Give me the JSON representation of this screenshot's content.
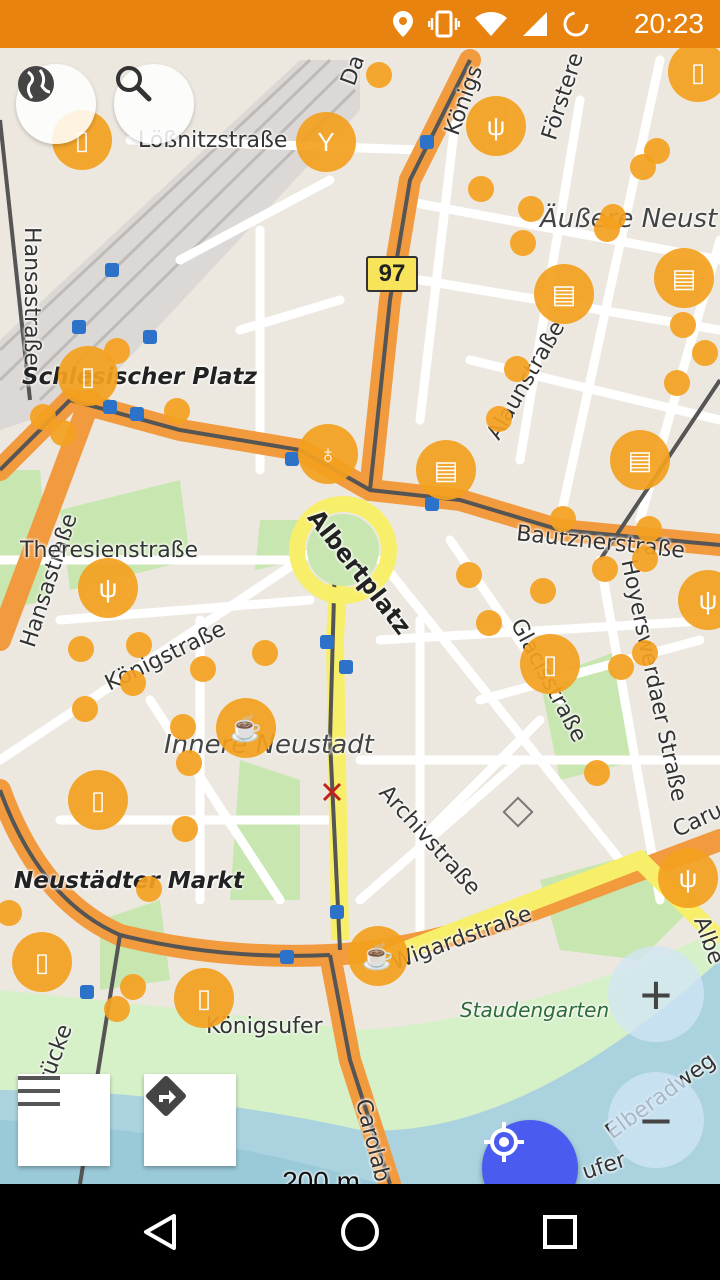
{
  "status_bar": {
    "time": "20:23",
    "icons": [
      "location-icon",
      "vibrate-icon",
      "wifi-icon",
      "signal-icon",
      "battery-charging-icon"
    ]
  },
  "map": {
    "road_ref": "97",
    "streets": {
      "loessnitz": "Lößnitzstraße",
      "hansa_top": "Hansastraße",
      "hansa_left": "Hansastraße",
      "theresien": "Theresienstraße",
      "koenig": "Königstraße",
      "koenig_top": "Königs",
      "foerster": "Förstere",
      "aaun": "Alaunstraße",
      "bautzner": "Bautznerstraße",
      "hoyerswerdaer": "Hoyerswerdaer Straße",
      "glacis": "Glacisstraße",
      "archiv": "Archivstraße",
      "wigard": "Wigardstraße",
      "koenigsufer": "Königsufer",
      "carola": "Carolab",
      "carus": "Caru",
      "albert": "Albe",
      "elberadweg": "Elberadweg",
      "ufer": "ufer",
      "bruecke": "brücke",
      "da": "Da"
    },
    "places": {
      "schlesischer_platz": "Schlesischer Platz",
      "albertplatz": "Albertplatz",
      "neustaedter_markt": "Neustädter Markt",
      "innere_neustadt": "Innere Neustadt",
      "aeussere_neustadt": "Äußere Neust",
      "staudengarten": "Staudengarten"
    }
  },
  "controls": {
    "layers_icon": "globe-icon",
    "search_icon": "search-icon",
    "menu_icon": "menu-icon",
    "directions_icon": "directions-icon",
    "zoom_in_label": "+",
    "zoom_out_label": "−",
    "locate_icon": "my-location-icon"
  },
  "scale_bar": {
    "label": "200 m"
  },
  "colors": {
    "status_bar": "#e8830f",
    "poi": "#f4a11f",
    "locate_button": "#4a5cf0",
    "major_road": "#f19a3e",
    "water": "#aad3df",
    "park": "#c8e6b0"
  },
  "navigation_bar": {
    "icons": [
      "back-icon",
      "home-icon",
      "recents-icon"
    ]
  }
}
